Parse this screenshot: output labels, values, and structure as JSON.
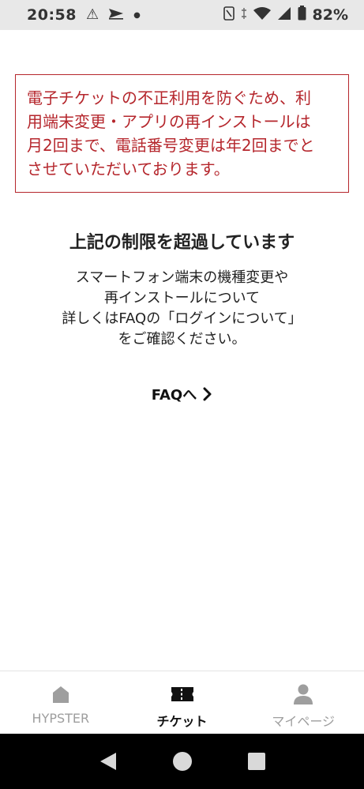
{
  "status_bar": {
    "time": "20:58",
    "battery": "82%",
    "icons": [
      "warning-icon",
      "send-icon",
      "dot-icon",
      "nfc-icon",
      "vibrate-icon",
      "wifi-icon",
      "signal-icon",
      "battery-icon"
    ]
  },
  "warning": {
    "lines": [
      "電子チケットの不正利用を防ぐため、利",
      "用端末変更・アプリの再インストールは",
      "月2回まで、電話番号変更は年2回までと",
      "させていただいております。"
    ],
    "color": "#b5262c"
  },
  "main": {
    "title": "上記の制限を超過しています",
    "body_lines": [
      "スマートフォン端末の機種変更や",
      "再インストールについて",
      "詳しくはFAQの「ログインについて」",
      "をご確認ください。"
    ],
    "faq_link": "FAQへ"
  },
  "bottom_nav": {
    "items": [
      {
        "label": "HYPSTER",
        "icon": "home-icon",
        "active": false
      },
      {
        "label": "チケット",
        "icon": "ticket-icon",
        "active": true
      },
      {
        "label": "マイページ",
        "icon": "user-icon",
        "active": false
      }
    ]
  },
  "android_nav": [
    "back-icon",
    "home-circle-icon",
    "recents-icon"
  ]
}
